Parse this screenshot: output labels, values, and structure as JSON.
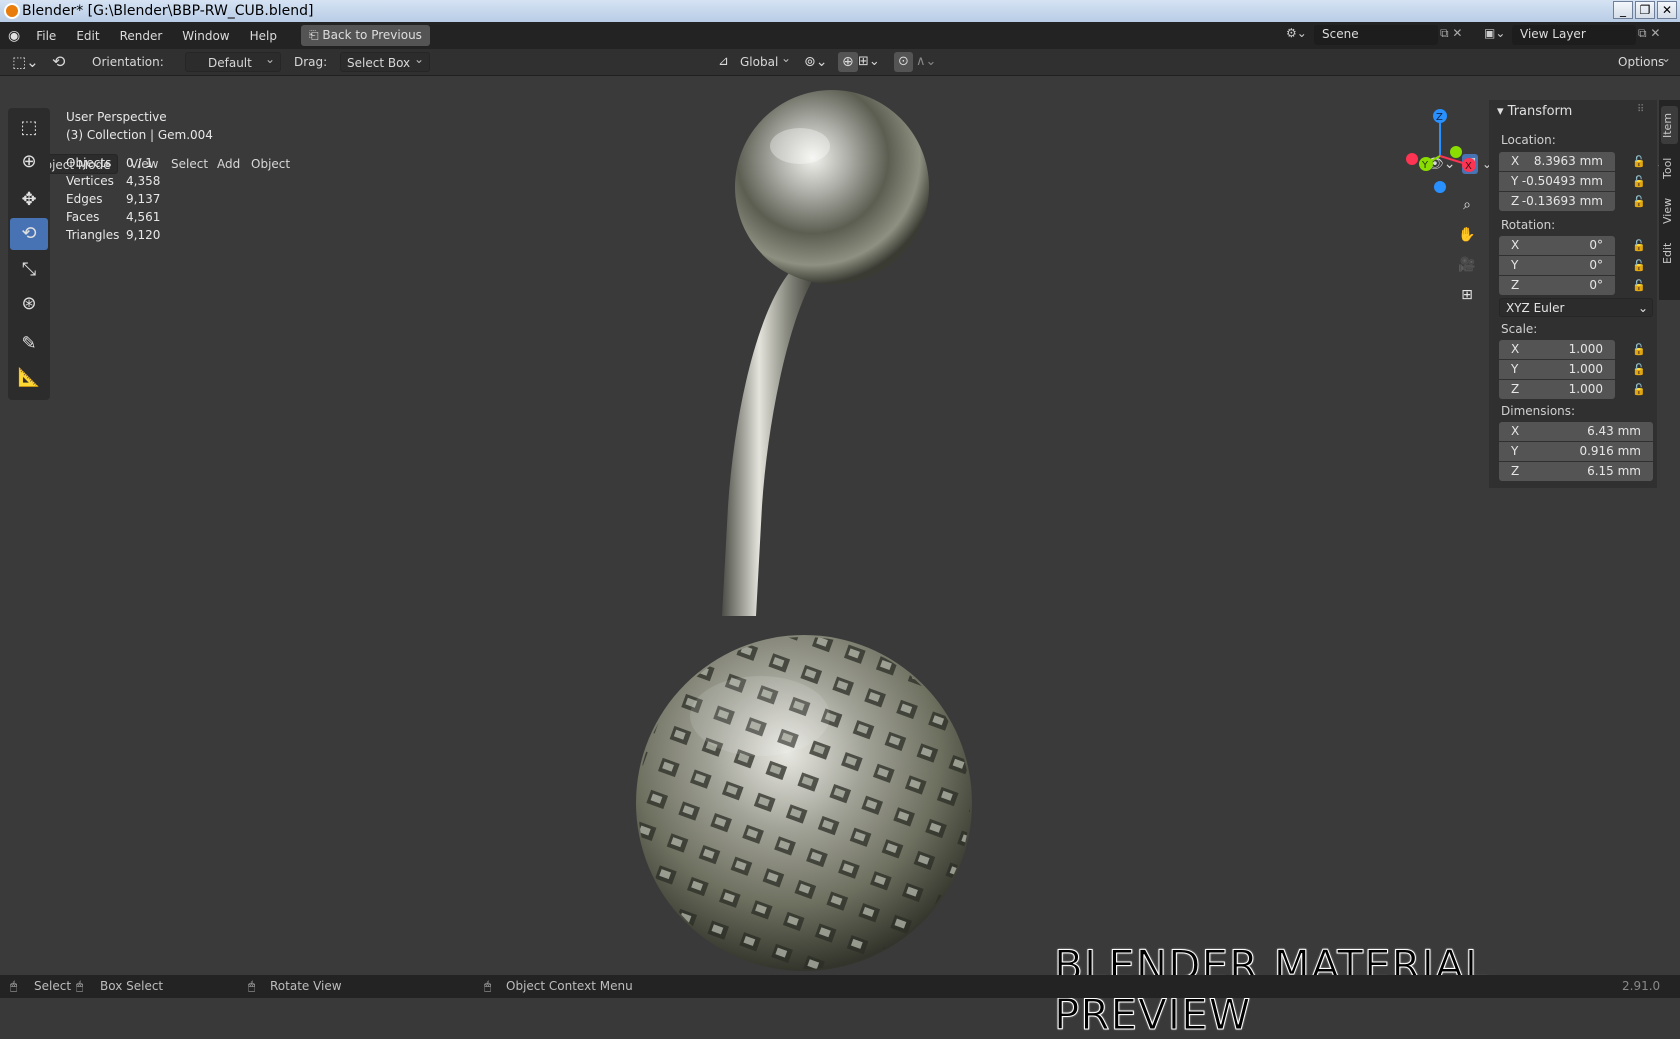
{
  "window": {
    "title": "Blender* [G:\\Blender\\BBP-RW_CUB.blend]"
  },
  "menubar": {
    "items": [
      "File",
      "Edit",
      "Render",
      "Window",
      "Help"
    ],
    "back_button": "Back to Previous",
    "scene_label": "Scene",
    "view_layer_label": "View Layer"
  },
  "tool_header": {
    "orientation_label": "Orientation:",
    "orientation_value": "Default",
    "drag_label": "Drag:",
    "drag_value": "Select Box",
    "transform_orientation": "Global",
    "options_label": "Options"
  },
  "viewport_header": {
    "mode": "Object Mode",
    "menus": [
      "View",
      "Select",
      "Add",
      "Object"
    ]
  },
  "overlay": {
    "view_name": "User Perspective",
    "collection": "(3) Collection | Gem.004",
    "stats": [
      {
        "label": "Objects",
        "value": "0 / 1"
      },
      {
        "label": "Vertices",
        "value": "4,358"
      },
      {
        "label": "Edges",
        "value": "9,137"
      },
      {
        "label": "Faces",
        "value": "4,561"
      },
      {
        "label": "Triangles",
        "value": "9,120"
      }
    ]
  },
  "npanel": {
    "section": "Transform",
    "location_label": "Location:",
    "location": [
      {
        "axis": "X",
        "value": "8.3963 mm"
      },
      {
        "axis": "Y",
        "value": "-0.50493 mm"
      },
      {
        "axis": "Z",
        "value": "-0.13693 mm"
      }
    ],
    "rotation_label": "Rotation:",
    "rotation": [
      {
        "axis": "X",
        "value": "0°"
      },
      {
        "axis": "Y",
        "value": "0°"
      },
      {
        "axis": "Z",
        "value": "0°"
      }
    ],
    "rotation_mode": "XYZ Euler",
    "scale_label": "Scale:",
    "scale": [
      {
        "axis": "X",
        "value": "1.000"
      },
      {
        "axis": "Y",
        "value": "1.000"
      },
      {
        "axis": "Z",
        "value": "1.000"
      }
    ],
    "dimensions_label": "Dimensions:",
    "dimensions": [
      {
        "axis": "X",
        "value": "6.43 mm"
      },
      {
        "axis": "Y",
        "value": "0.916 mm"
      },
      {
        "axis": "Z",
        "value": "6.15 mm"
      }
    ],
    "tabs": [
      "Item",
      "Tool",
      "View",
      "Edit"
    ]
  },
  "gizmo": {
    "axes": [
      "X",
      "Y",
      "Z"
    ],
    "colors": {
      "x": "#ff3352",
      "y": "#8bdc00",
      "z": "#2890ff"
    }
  },
  "statusbar": {
    "select": "Select",
    "box_select": "Box Select",
    "rotate_view": "Rotate View",
    "context_menu": "Object Context Menu",
    "version": "2.91.0"
  },
  "watermark": "BLENDER MATERIAL PREVIEW",
  "colors": {
    "accent": "#4772b3",
    "background": "#3a3a3a"
  }
}
